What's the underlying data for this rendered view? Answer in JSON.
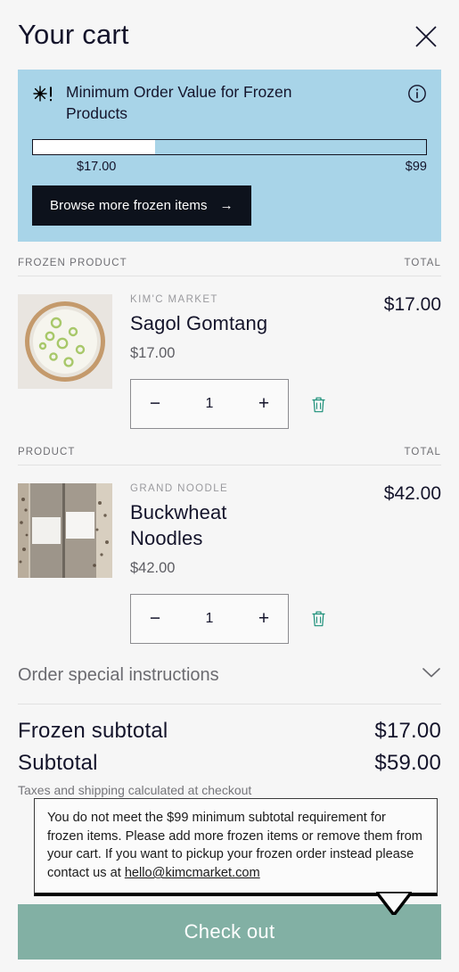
{
  "header": {
    "title": "Your cart",
    "close_label": "Close cart"
  },
  "frozen_banner": {
    "title": "Minimum Order Value for Frozen Products",
    "alert_icon": "snowflake-alert-icon",
    "info_icon": "info-circle-icon",
    "progress": {
      "current_label": "$17.00",
      "target_label": "$99",
      "current_value": 17,
      "target_value": 99,
      "fill_percent": 31
    },
    "browse_button_label": "Browse more frozen items",
    "browse_button_arrow": "→",
    "background_color": "#a8d4e8"
  },
  "sections": [
    {
      "col_product": "FROZEN PRODUCT",
      "col_total": "TOTAL"
    },
    {
      "col_product": "PRODUCT",
      "col_total": "TOTAL"
    }
  ],
  "items": [
    {
      "vendor": "KIM'C MARKET",
      "name": "Sagol Gomtang",
      "price": "$17.00",
      "total": "$17.00",
      "quantity": "1",
      "decrease_label": "−",
      "increase_label": "+",
      "remove_icon": "trash-icon",
      "image_alt": "bowl-of-white-broth-with-scallions"
    },
    {
      "vendor": "GRAND NOODLE",
      "name": "Buckwheat Noodles",
      "price": "$42.00",
      "total": "$42.00",
      "quantity": "1",
      "decrease_label": "−",
      "increase_label": "+",
      "remove_icon": "trash-icon",
      "image_alt": "two-bundles-of-buckwheat-noodles-on-wood"
    }
  ],
  "special_instructions": {
    "label": "Order special instructions",
    "chevron_icon": "chevron-down-icon"
  },
  "totals": {
    "frozen_subtotal_label": "Frozen subtotal",
    "frozen_subtotal_value": "$17.00",
    "subtotal_label": "Subtotal",
    "subtotal_value": "$59.00",
    "taxes_note": "Taxes and shipping calculated at checkout"
  },
  "tooltip": {
    "text_before_email": "You do not meet the $99 minimum subtotal requirement for frozen items. Please add more frozen items or remove them from your cart. If you want to pickup your frozen order instead please contact us at ",
    "email": "hello@kimcmarket.com"
  },
  "checkout": {
    "label": "Check out",
    "color": "#82b0a4"
  }
}
